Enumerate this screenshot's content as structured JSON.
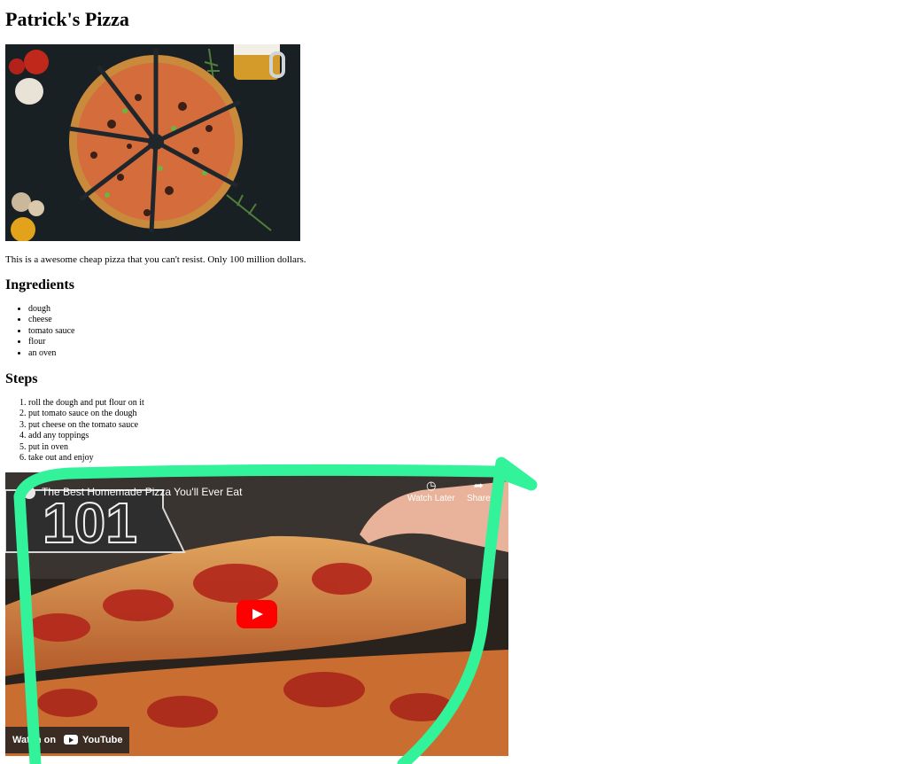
{
  "recipe": {
    "title": "Patrick's Pizza",
    "description": "This is a awesome cheap pizza that you can't resist. Only 100 million dollars."
  },
  "ingredients": {
    "heading": "Ingredients",
    "items": [
      "dough",
      "cheese",
      "tomato sauce",
      "flour",
      "an oven"
    ]
  },
  "steps": {
    "heading": "Steps",
    "items": [
      "roll the dough and put flour on it",
      "put tomato sauce on the dough",
      "put cheese on the tomato sauce",
      "add any toppings",
      "put in oven",
      "take out and enjoy"
    ]
  },
  "video": {
    "title": "The Best Homemade Pizza You'll Ever Eat",
    "badge": "101",
    "watch_later": "Watch Later",
    "share": "Share",
    "watch_on": "Watch on",
    "platform": "YouTube"
  },
  "colors": {
    "annotation_stroke": "#33f39a",
    "play_button": "#ff0000"
  }
}
